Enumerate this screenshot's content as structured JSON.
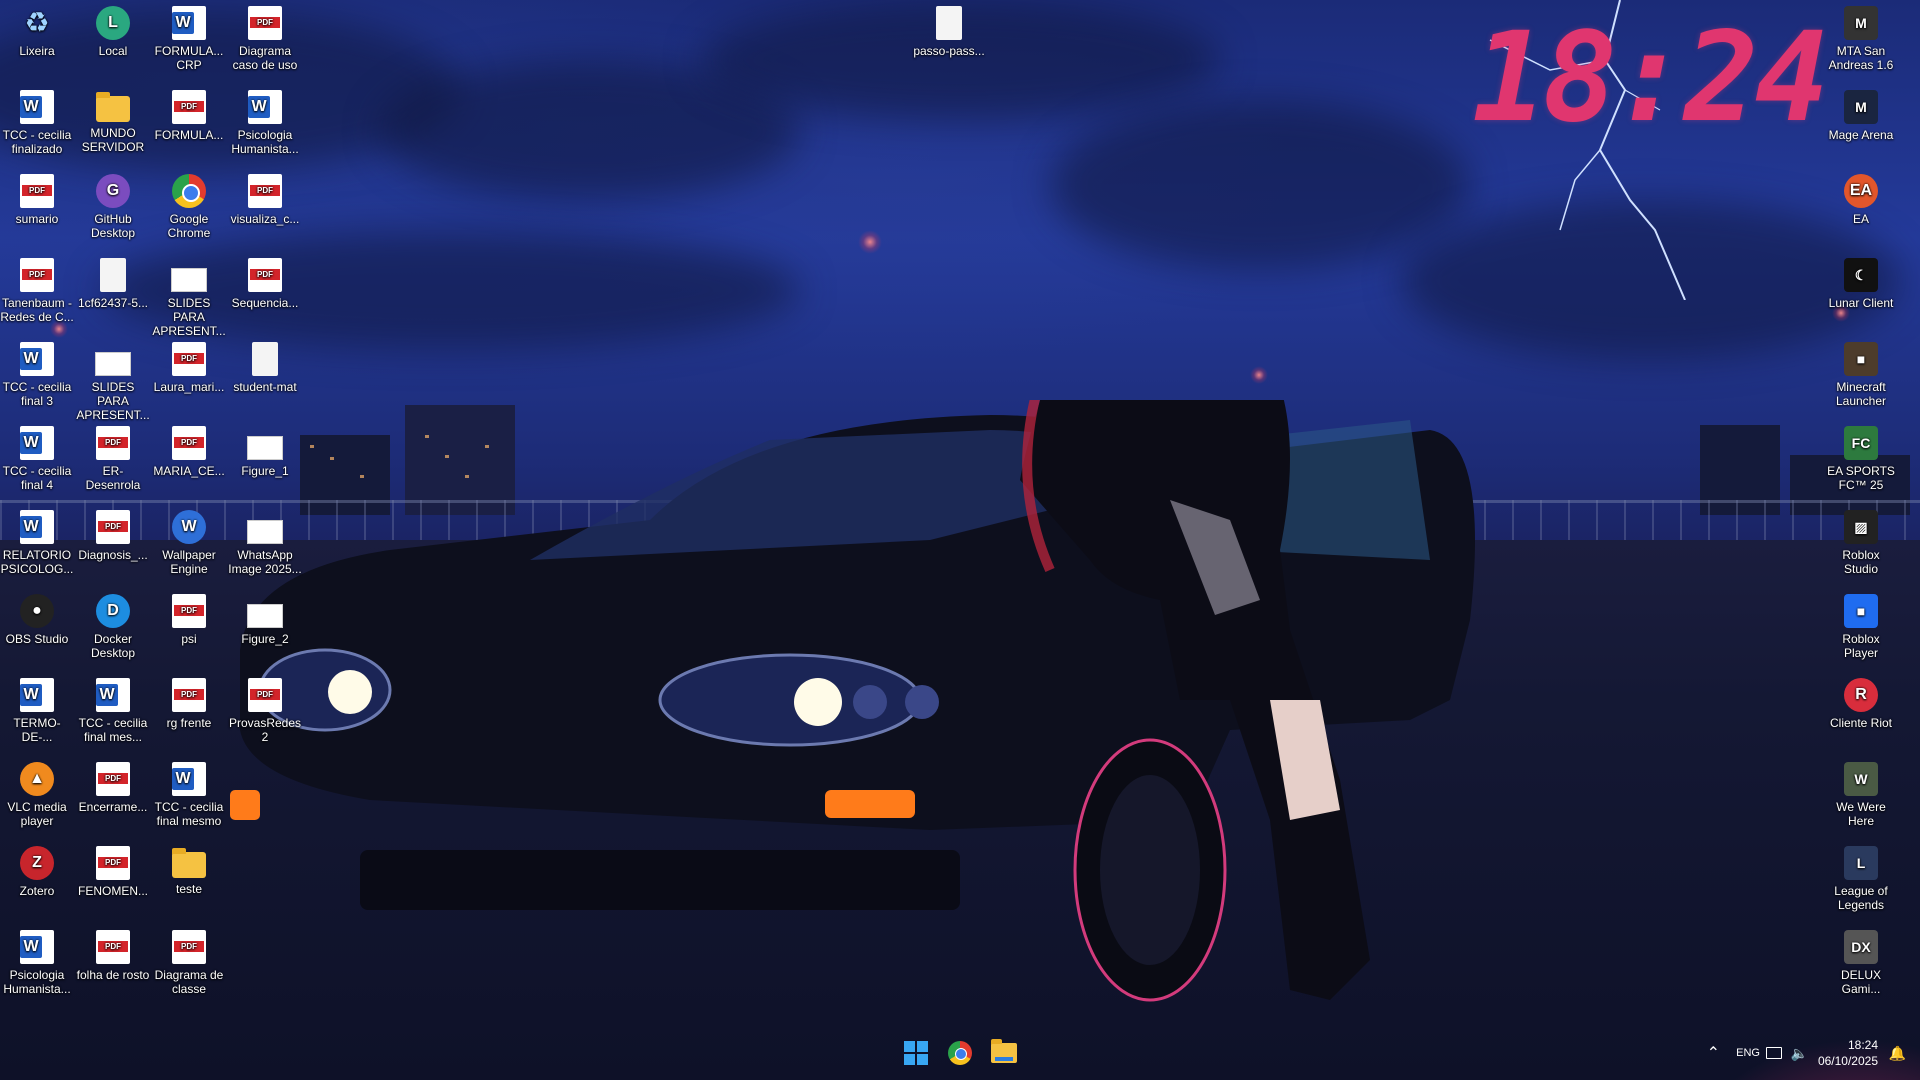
{
  "wallpaper": {
    "clock": "18:24",
    "accent": "#e0366f"
  },
  "desktop": {
    "col1": [
      {
        "label": "Lixeira",
        "icon": "recycle-bin-icon"
      },
      {
        "label": "TCC - cecilia finalizado",
        "icon": "word-doc-icon"
      },
      {
        "label": "sumario",
        "icon": "pdf-icon"
      },
      {
        "label": "Tanenbaum - Redes de C...",
        "icon": "pdf-icon"
      },
      {
        "label": "TCC - cecilia final 3",
        "icon": "word-doc-icon"
      },
      {
        "label": "TCC - cecilia final 4",
        "icon": "word-doc-icon"
      },
      {
        "label": "RELATORIO PSICOLOG...",
        "icon": "word-doc-icon"
      },
      {
        "label": "OBS Studio",
        "icon": "obs-icon"
      },
      {
        "label": "TERMO-DE-...",
        "icon": "word-doc-icon"
      },
      {
        "label": "VLC media player",
        "icon": "vlc-icon"
      },
      {
        "label": "Zotero",
        "icon": "zotero-icon"
      },
      {
        "label": "Psicologia Humanista...",
        "icon": "word-doc-icon"
      }
    ],
    "col2": [
      {
        "label": "Local",
        "icon": "local-icon"
      },
      {
        "label": "MUNDO SERVIDOR",
        "icon": "folder-icon"
      },
      {
        "label": "GitHub Desktop",
        "icon": "github-desktop-icon"
      },
      {
        "label": "1cf62437-5...",
        "icon": "file-icon"
      },
      {
        "label": "SLIDES PARA APRESENT...",
        "icon": "slides-icon"
      },
      {
        "label": "ER-Desenrola",
        "icon": "pdf-icon"
      },
      {
        "label": "Diagnosis_...",
        "icon": "pdf-icon"
      },
      {
        "label": "Docker Desktop",
        "icon": "docker-icon"
      },
      {
        "label": "TCC - cecilia final mes...",
        "icon": "word-doc-icon"
      },
      {
        "label": "Encerrame...",
        "icon": "pdf-icon"
      },
      {
        "label": "FENOMEN...",
        "icon": "pdf-icon"
      },
      {
        "label": "folha de rosto",
        "icon": "pdf-icon"
      }
    ],
    "col3": [
      {
        "label": "FORMULA... CRP",
        "icon": "word-doc-icon"
      },
      {
        "label": "FORMULA...",
        "icon": "pdf-icon"
      },
      {
        "label": "Google Chrome",
        "icon": "chrome-icon"
      },
      {
        "label": "SLIDES PARA APRESENT...",
        "icon": "slides-icon"
      },
      {
        "label": "Laura_mari...",
        "icon": "pdf-icon"
      },
      {
        "label": "MARIA_CE...",
        "icon": "pdf-icon"
      },
      {
        "label": "Wallpaper Engine",
        "icon": "wallpaper-engine-icon"
      },
      {
        "label": "psi",
        "icon": "pdf-icon"
      },
      {
        "label": "rg frente",
        "icon": "pdf-icon"
      },
      {
        "label": "TCC - cecilia final mesmo",
        "icon": "word-doc-icon"
      },
      {
        "label": "teste",
        "icon": "folder-icon"
      },
      {
        "label": "Diagrama de classe",
        "icon": "pdf-icon"
      }
    ],
    "col4": [
      {
        "label": "Diagrama caso de uso",
        "icon": "pdf-icon"
      },
      {
        "label": "Psicologia Humanista...",
        "icon": "word-doc-icon"
      },
      {
        "label": "visualiza_c...",
        "icon": "pdf-icon"
      },
      {
        "label": "Sequencia...",
        "icon": "pdf-icon"
      },
      {
        "label": "student-mat",
        "icon": "file-icon"
      },
      {
        "label": "Figure_1",
        "icon": "image-icon"
      },
      {
        "label": "WhatsApp Image 2025...",
        "icon": "image-icon"
      },
      {
        "label": "Figure_2",
        "icon": "image-icon"
      },
      {
        "label": "ProvasRedes2",
        "icon": "pdf-icon"
      }
    ],
    "center": [
      {
        "label": "passo-pass...",
        "icon": "file-icon"
      }
    ],
    "right": [
      {
        "label": "MTA San Andreas 1.6",
        "icon": "mta-icon"
      },
      {
        "label": "Mage Arena",
        "icon": "mage-arena-icon"
      },
      {
        "label": "EA",
        "icon": "ea-icon"
      },
      {
        "label": "Lunar Client",
        "icon": "lunar-client-icon"
      },
      {
        "label": "Minecraft Launcher",
        "icon": "minecraft-icon"
      },
      {
        "label": "EA SPORTS FC™ 25",
        "icon": "ea-sports-fc-icon"
      },
      {
        "label": "Roblox Studio",
        "icon": "roblox-studio-icon"
      },
      {
        "label": "Roblox Player",
        "icon": "roblox-player-icon"
      },
      {
        "label": "Cliente Riot",
        "icon": "riot-client-icon"
      },
      {
        "label": "We Were Here",
        "icon": "we-were-here-icon"
      },
      {
        "label": "League of Legends",
        "icon": "league-icon"
      },
      {
        "label": "DELUX Gami...",
        "icon": "delux-icon"
      }
    ]
  },
  "taskbar": {
    "apps": [
      "start-icon",
      "chrome-icon",
      "file-explorer-icon"
    ],
    "language": "ENG",
    "time": "18:24",
    "date": "06/10/2025"
  }
}
